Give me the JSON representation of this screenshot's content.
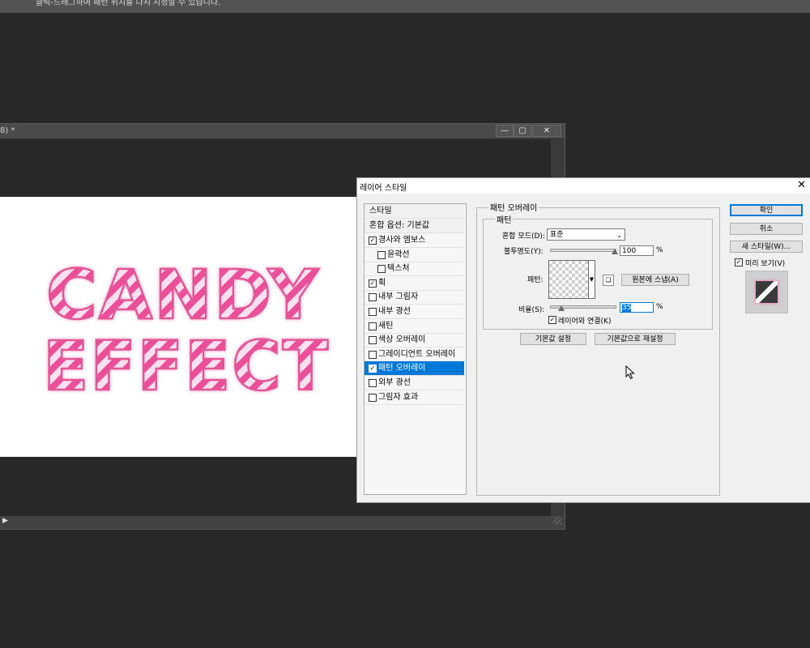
{
  "topbar": {
    "text": "클릭-드래그하여 패턴 위치를 다시 지정할 수 있습니다."
  },
  "document": {
    "title": "8) *",
    "minimize": "—",
    "maximize": "▢",
    "close": "✕",
    "status_arrow": "▶"
  },
  "canvas": {
    "line1": "CANDY",
    "line2": "EFFECT",
    "colors": {
      "stripe": "#ec4f9a",
      "light": "#fbe0ee",
      "outline": "#e35596"
    }
  },
  "dialog": {
    "title": "레이어 스타일",
    "close": "✕",
    "styles_header": "스타일",
    "blend_header": "혼합 옵션: 기본값",
    "effects": [
      {
        "label": "경사와 엠보스",
        "checked": true,
        "sub": false,
        "mark": "✓"
      },
      {
        "label": "윤곽선",
        "checked": false,
        "sub": true,
        "mark": ""
      },
      {
        "label": "텍스처",
        "checked": false,
        "sub": true,
        "mark": ""
      },
      {
        "label": "획",
        "checked": true,
        "sub": false,
        "mark": "✓"
      },
      {
        "label": "내부 그림자",
        "checked": false,
        "sub": false,
        "mark": ""
      },
      {
        "label": "내부 광선",
        "checked": false,
        "sub": false,
        "mark": ""
      },
      {
        "label": "새틴",
        "checked": false,
        "sub": false,
        "mark": ""
      },
      {
        "label": "색상 오버레이",
        "checked": false,
        "sub": false,
        "mark": ""
      },
      {
        "label": "그레이디언트 오버레이",
        "checked": false,
        "sub": false,
        "mark": ""
      },
      {
        "label": "패턴 오버레이",
        "checked": true,
        "sub": false,
        "selected": true,
        "mark": "✓"
      },
      {
        "label": "외부 광선",
        "checked": false,
        "sub": false,
        "mark": ""
      },
      {
        "label": "그림자 효과",
        "checked": false,
        "sub": false,
        "mark": ""
      }
    ],
    "panel": {
      "section_title": "패턴 오버레이",
      "group_title": "패턴",
      "blend_mode_label": "혼합 모드(D):",
      "blend_mode_value": "표준",
      "opacity_label": "불투명도(Y):",
      "opacity_value": "100",
      "opacity_level": 1.0,
      "pattern_label": "패턴:",
      "snap_button": "원본에 스냅(A)",
      "scale_label": "비율(S):",
      "scale_value": "35",
      "link_label": "레이어와 연결(K)",
      "link_checked": "✓",
      "default_button": "기본값 설정",
      "reset_button": "기본값으로 재설정",
      "percent": "%"
    },
    "buttons": {
      "ok": "확인",
      "cancel": "취소",
      "new_style": "새 스타일(W)...",
      "preview_label": "미리 보기(V)",
      "preview_checked": "✓"
    }
  }
}
